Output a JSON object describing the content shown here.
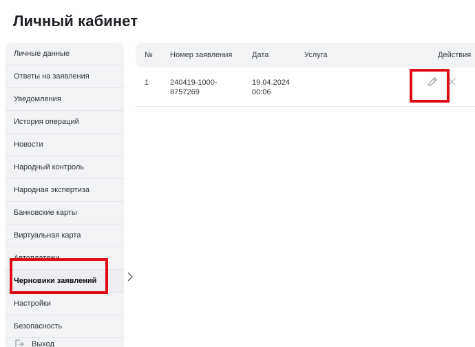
{
  "page": {
    "title": "Личный кабинет"
  },
  "sidebar": {
    "items": [
      {
        "label": "Личные данные"
      },
      {
        "label": "Ответы на заявления"
      },
      {
        "label": "Уведомления"
      },
      {
        "label": "История операций"
      },
      {
        "label": "Новости"
      },
      {
        "label": "Народный контроль"
      },
      {
        "label": "Народная экспертиза"
      },
      {
        "label": "Банковские карты"
      },
      {
        "label": "Виртуальная карта"
      },
      {
        "label": "Автоплатежи"
      },
      {
        "label": "Черновики заявлений",
        "active": true
      },
      {
        "label": "Настройки"
      },
      {
        "label": "Безопасность"
      },
      {
        "label": "Выход",
        "icon": "logout-icon"
      }
    ]
  },
  "table": {
    "columns": {
      "number": "№",
      "application_number": "Номер заявления",
      "date": "Дата",
      "service": "Услуга",
      "actions": "Действия"
    },
    "rows": [
      {
        "number": "1",
        "application_number_line1": "240419-1000-",
        "application_number_line2": "8757269",
        "date_line1": "19.04.2024",
        "date_line2": "00:06",
        "service": "",
        "actions": [
          "pencil-icon",
          "close-icon"
        ]
      }
    ]
  },
  "colors": {
    "highlight": "#e10a17",
    "sidebar_bg": "#f2f3f5",
    "text": "#2e3237"
  }
}
